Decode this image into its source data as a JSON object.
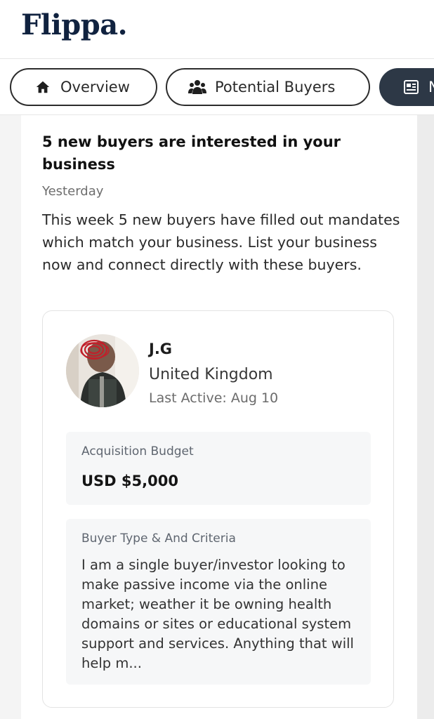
{
  "header": {
    "logo": "Flippa."
  },
  "tabs": [
    {
      "label": "Overview",
      "icon": "home-icon"
    },
    {
      "label": "Potential Buyers",
      "icon": "users-icon"
    },
    {
      "label": "N",
      "icon": "newspaper-icon"
    }
  ],
  "notification": {
    "title": "5 new buyers are interested in your business",
    "time": "Yesterday",
    "body": "This week 5 new buyers have filled out mandates which match your business. List your business now and connect directly with these buyers."
  },
  "buyer": {
    "name": "J.G",
    "country": "United Kingdom",
    "last_active": "Last Active: Aug 10",
    "budget_label": "Acquisition Budget",
    "budget_value": "USD $5,000",
    "type_label": "Buyer Type & And Criteria",
    "type_text": "I am a single buyer/investor looking to make passive income via the online market; weather it be owning health domains or sites or educational system support and services. Anything that will help m..."
  },
  "colors": {
    "brand": "#10223f",
    "active_tab": "#2d3846",
    "avatar_scribble": "#c0202a"
  }
}
